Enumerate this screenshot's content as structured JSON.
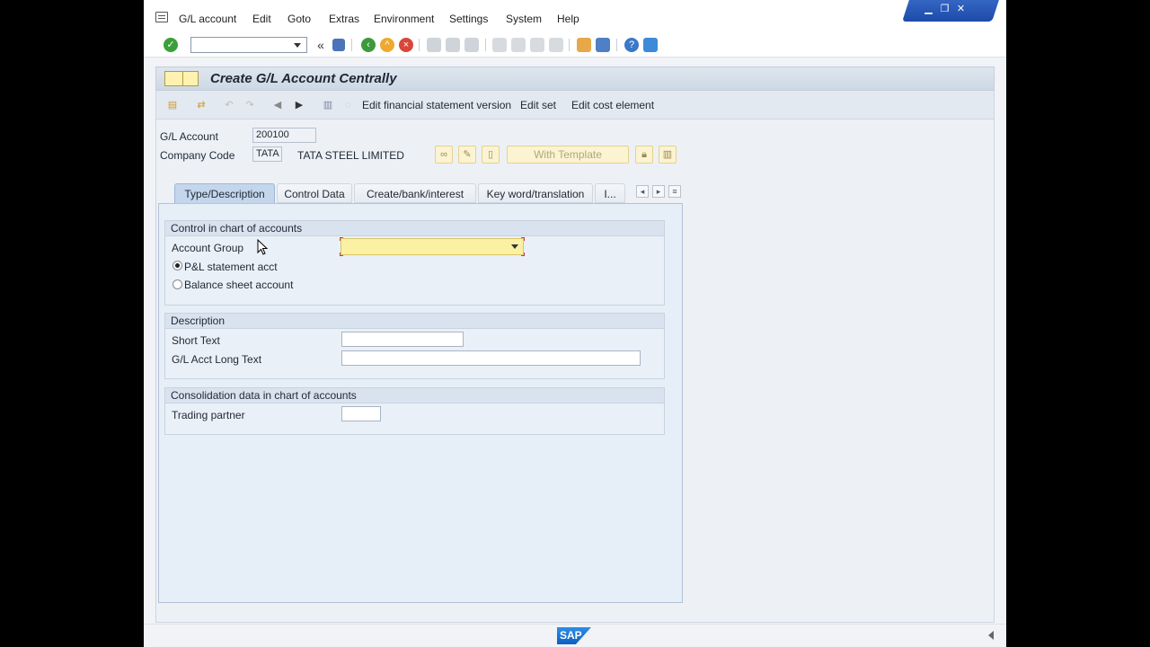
{
  "menu": {
    "items": [
      "G/L account",
      "Edit",
      "Goto",
      "Extras",
      "Environment",
      "Settings",
      "System",
      "Help"
    ]
  },
  "window_controls": {
    "minimize": "▁",
    "restore": "❐",
    "close": "✕"
  },
  "toolbar": {
    "command_value": "",
    "icons": [
      "enter-icon",
      "back-double-arrow-icon",
      "save-icon",
      "back-icon",
      "exit-icon",
      "cancel-icon",
      "print-icon",
      "find-icon",
      "find-next-icon",
      "first-page-icon",
      "previous-page-icon",
      "next-page-icon",
      "last-page-icon",
      "new-session-icon",
      "shortcut-icon",
      "help-icon",
      "customize-layout-icon"
    ]
  },
  "title": "Create G/L Account Centrally",
  "app_toolbar": {
    "links": [
      "Edit financial statement version",
      "Edit set",
      "Edit cost element"
    ]
  },
  "header": {
    "gl_account_label": "G/L Account",
    "gl_account_value": "200100",
    "company_code_label": "Company Code",
    "company_code_value": "TATA",
    "company_name": "TATA STEEL LIMITED",
    "template_button": "With Template"
  },
  "tabs": [
    {
      "label": "Type/Description",
      "active": true
    },
    {
      "label": "Control Data",
      "active": false
    },
    {
      "label": "Create/bank/interest",
      "active": false
    },
    {
      "label": "Key word/translation",
      "active": false
    },
    {
      "label": "I...",
      "active": false
    }
  ],
  "groups": {
    "control": {
      "title": "Control in chart of accounts",
      "account_group_label": "Account Group",
      "account_group_value": "",
      "radio_pl": "P&L statement acct",
      "radio_bs": "Balance sheet account",
      "selected": "P&L statement acct"
    },
    "description": {
      "title": "Description",
      "short_text_label": "Short Text",
      "short_text_value": "",
      "long_text_label": "G/L Acct Long Text",
      "long_text_value": ""
    },
    "consolidation": {
      "title": "Consolidation data in chart of accounts",
      "trading_partner_label": "Trading partner",
      "trading_partner_value": ""
    }
  },
  "footer": {
    "logo": "SAP"
  }
}
